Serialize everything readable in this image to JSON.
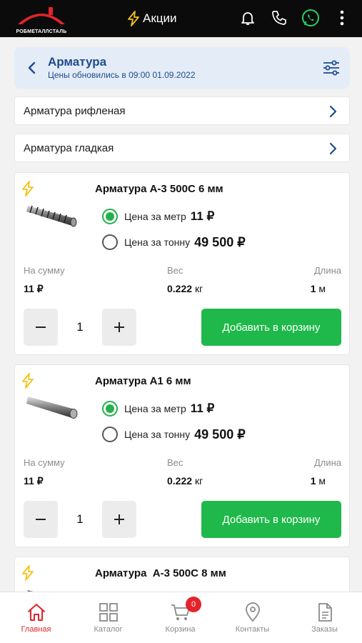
{
  "header": {
    "logo_text": "РОБМЕТАЛЛСТАЛЬ",
    "promo_label": "Акции",
    "icons": [
      "lightning-icon",
      "bell-icon",
      "phone-icon",
      "whatsapp-icon",
      "more-vertical-icon"
    ]
  },
  "category": {
    "title": "Арматура",
    "updated_prefix": "Цены обновились в",
    "updated_value": "09:00 01.09.2022"
  },
  "subcategories": [
    {
      "label": "Арматура рифленая"
    },
    {
      "label": "Арматура гладкая"
    }
  ],
  "products": [
    {
      "title": "Арматура А-3 500С 6 мм",
      "price_meter_label": "Цена за метр",
      "price_meter": "11 ₽",
      "price_ton_label": "Цена за тонну",
      "price_ton": "49 500 ₽",
      "selected": "meter",
      "sum_label": "На сумму",
      "sum_value": "11 ₽",
      "weight_label": "Вес",
      "weight_value": "0.222",
      "weight_unit": "кг",
      "length_label": "Длина",
      "length_value": "1",
      "length_unit": "м",
      "quantity": "1",
      "add_label": "Добавить в корзину"
    },
    {
      "title": "Арматура А1 6 мм",
      "price_meter_label": "Цена за метр",
      "price_meter": "11 ₽",
      "price_ton_label": "Цена за тонну",
      "price_ton": "49 500 ₽",
      "selected": "meter",
      "sum_label": "На сумму",
      "sum_value": "11 ₽",
      "weight_label": "Вес",
      "weight_value": "0.222",
      "weight_unit": "кг",
      "length_label": "Длина",
      "length_value": "1",
      "length_unit": "м",
      "quantity": "1",
      "add_label": "Добавить в корзину"
    },
    {
      "title": "Арматура  А-3 500С 8 мм"
    }
  ],
  "bottom_nav": {
    "items": [
      {
        "label": "Главная",
        "icon": "home-icon",
        "active": true
      },
      {
        "label": "Каталог",
        "icon": "grid-icon",
        "active": false
      },
      {
        "label": "Корзина",
        "icon": "cart-icon",
        "active": false
      },
      {
        "label": "Контакты",
        "icon": "location-pin-icon",
        "active": false
      },
      {
        "label": "Заказы",
        "icon": "document-icon",
        "active": false
      }
    ],
    "cart_badge": "0"
  },
  "colors": {
    "accent_green": "#1fb84a",
    "accent_red": "#d9282c",
    "header_blue": "#1e4b8f",
    "header_bg": "#e3ecf7",
    "bolt_yellow": "#f2c21b"
  }
}
